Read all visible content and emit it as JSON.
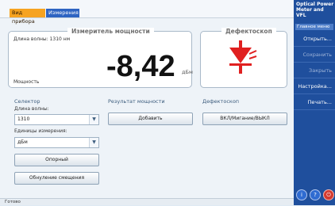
{
  "tabs": [
    {
      "label": "Вид прибора"
    },
    {
      "label": "Измерения"
    }
  ],
  "power_panel": {
    "title": "Измеритель мощности",
    "wavelength": "Длина волны: 1310 нм",
    "value": "-8,42",
    "unit": "дБм",
    "footer": "Мощность"
  },
  "vfl_panel": {
    "title": "Дефектоскоп"
  },
  "selector": {
    "title": "Селектор",
    "wavelength_label": "Длина волны:",
    "wavelength_value": "1310",
    "units_label": "Единицы измерения:",
    "units_value": "дБм",
    "reference_button": "Опорный",
    "reset_offset_button": "Обнуление смещения"
  },
  "power_result": {
    "title": "Результат мощности",
    "add_button": "Добавить"
  },
  "vfl_section": {
    "title": "Дефектоскоп",
    "toggle_button": "ВКЛ/Мигание/ВЫКЛ"
  },
  "status": {
    "text": "Готово"
  },
  "sidebar": {
    "title": "Optical Power Meter and VFL",
    "subtitle": "Главное меню",
    "items": [
      {
        "label": "Открыть..."
      },
      {
        "label": "Сохранить"
      },
      {
        "label": "Закрыть"
      },
      {
        "label": "Настройка..."
      },
      {
        "label": "Печать..."
      }
    ]
  },
  "colors": {
    "active_tab": "#f6a321",
    "inactive_tab": "#2e64c2",
    "sidebar": "#1f4f9d",
    "laser_icon": "#e02020"
  }
}
